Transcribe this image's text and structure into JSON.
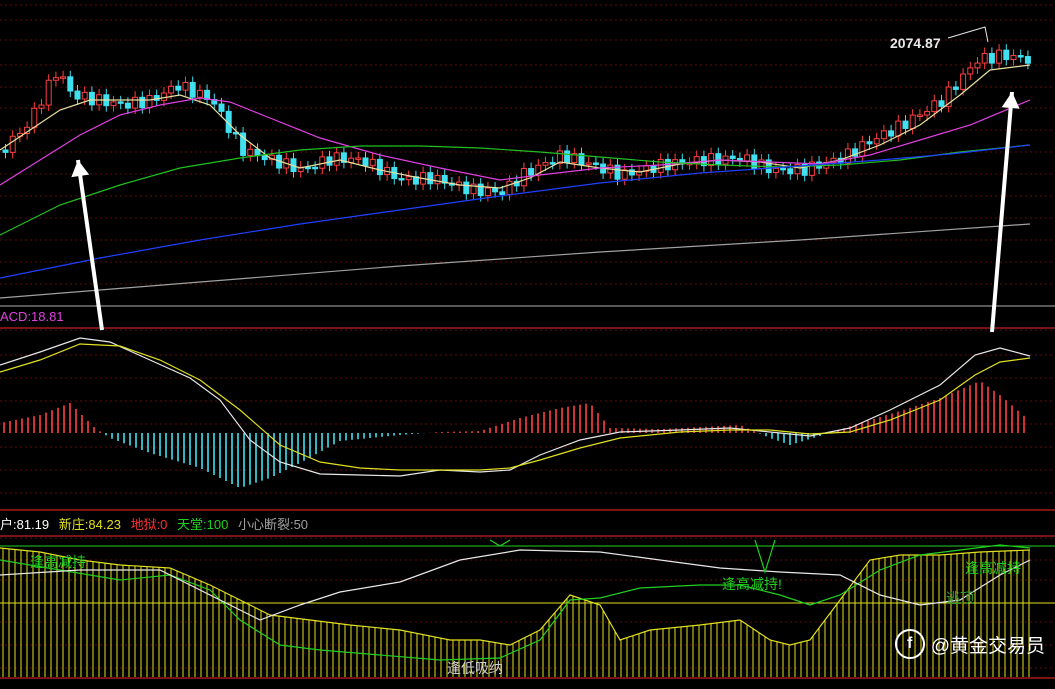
{
  "chart_data": [
    {
      "type": "candlestick",
      "price_label": "2074.87",
      "moving_averages": [
        "ma-yellow",
        "ma-magenta",
        "ma-green",
        "ma-blue",
        "ma-gray"
      ],
      "colors": {
        "up": "#ff4040",
        "down": "#40e0f0",
        "ma_fast": "#e8e0a0",
        "ma_mid": "#e040e0",
        "ma_slow": "#20c020",
        "ma_long": "#2040ff",
        "ma_longest": "#a0a0a0"
      }
    },
    {
      "type": "macd",
      "label": "ACD:18.81",
      "colors": {
        "dif": "#e8e8e8",
        "dea": "#e0e020",
        "pos": "#ff4040",
        "neg": "#40e0f0"
      }
    },
    {
      "type": "indicator",
      "labels": [
        {
          "text": "户:81.19",
          "color": "#ffffff"
        },
        {
          "text": "新庄:84.23",
          "color": "#e0e020"
        },
        {
          "text": "地狱:0",
          "color": "#ff3030"
        },
        {
          "text": "天堂:100",
          "color": "#20d020"
        },
        {
          "text": "小心断裂:50",
          "color": "#a0a0a0"
        }
      ],
      "annotations": [
        "逢高减持",
        "逢高减持!",
        "逢高减持",
        "逃顶",
        "逢低吸纳"
      ]
    }
  ],
  "watermark": "@黄金交易员"
}
